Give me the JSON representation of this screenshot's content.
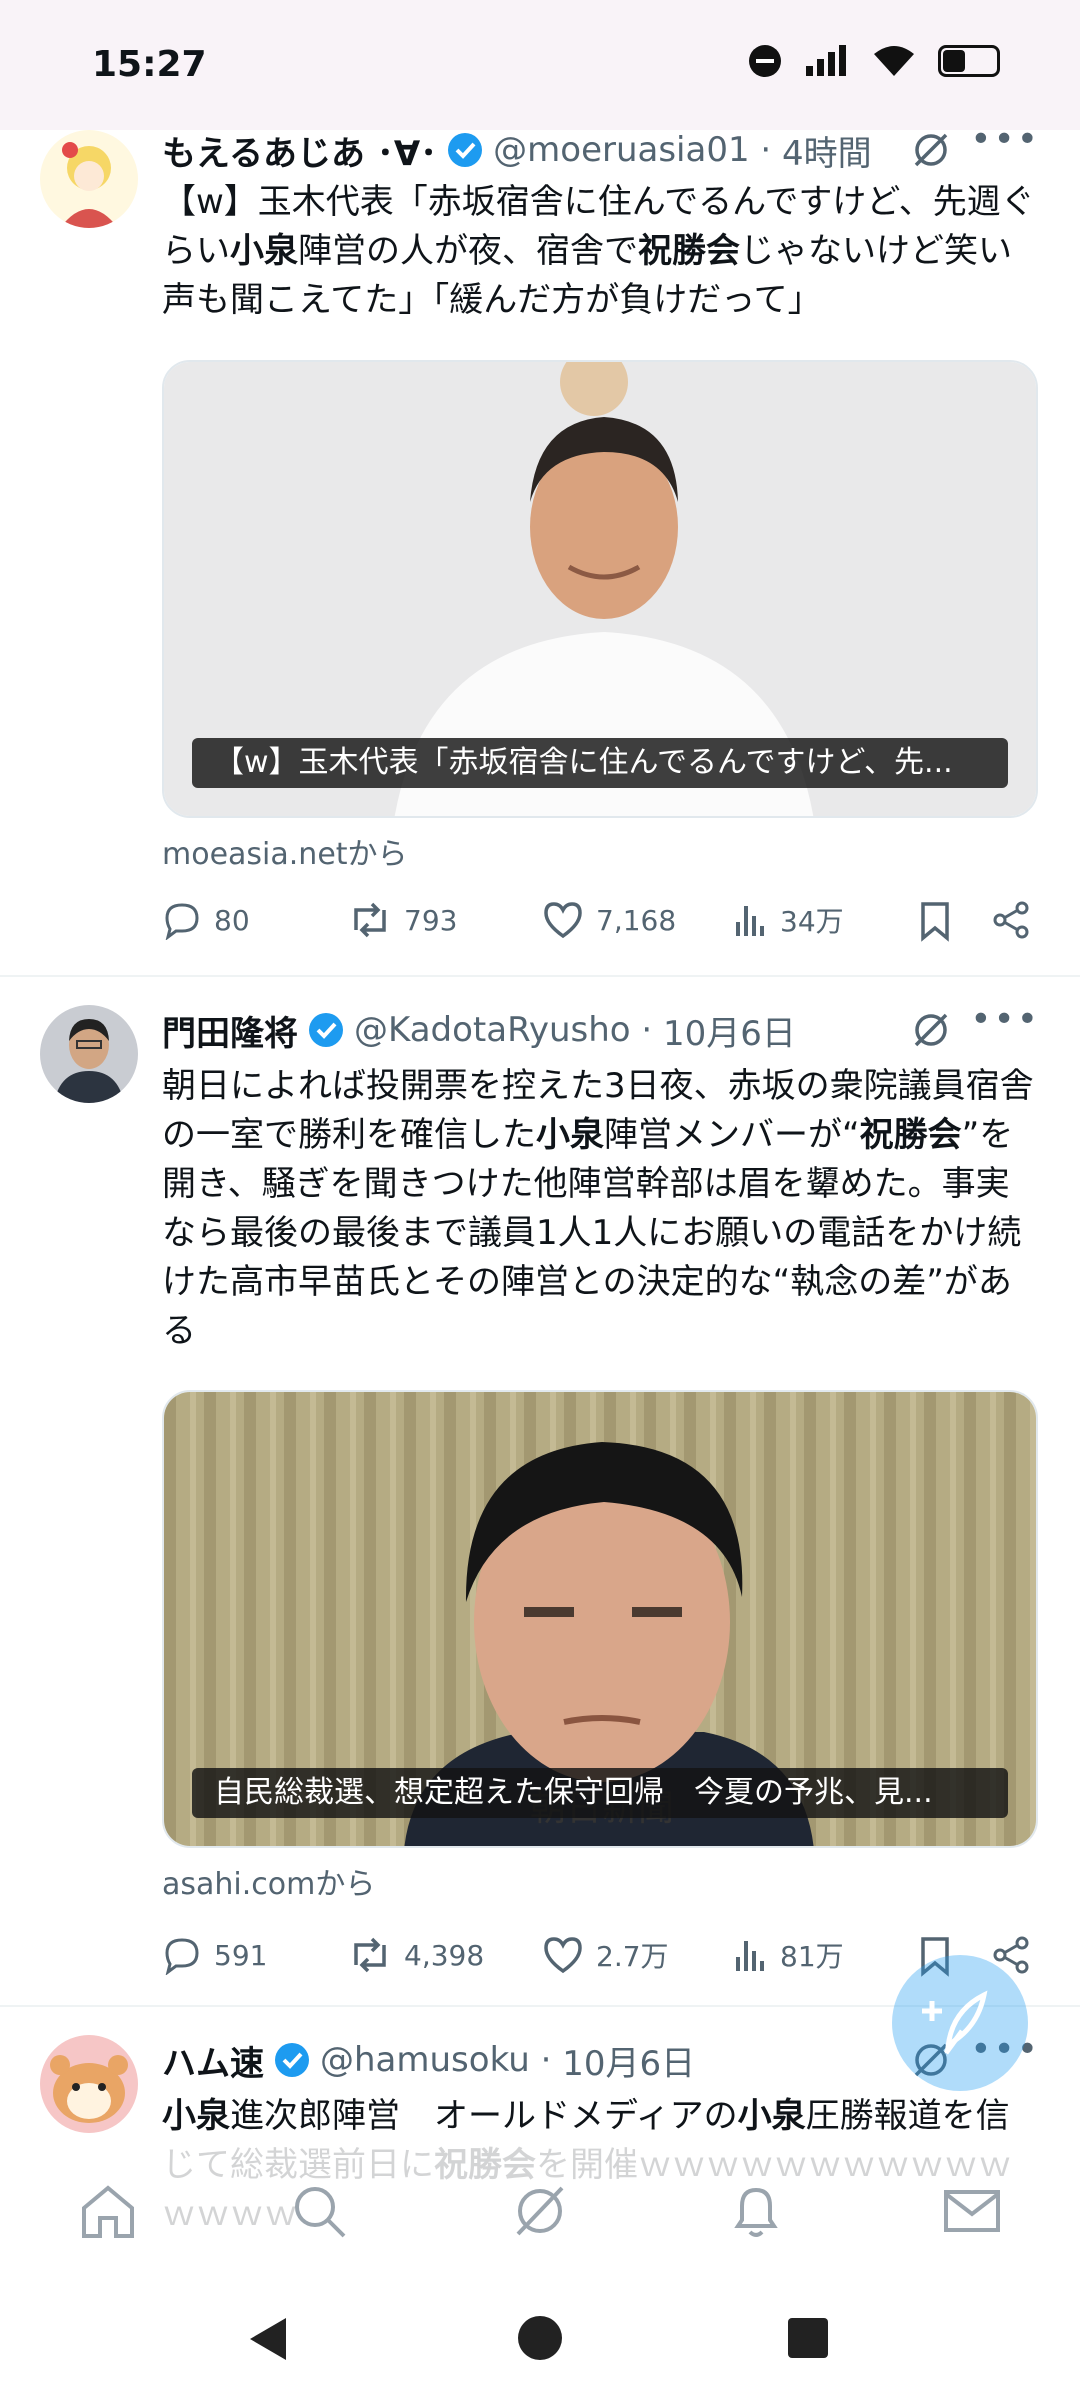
{
  "status_bar": {
    "time": "15:27"
  },
  "tweets": [
    {
      "name": "もえるあじあ ･∀･",
      "handle": "@moeruasia01",
      "time": "4時間",
      "segments": [
        {
          "t": "【w】玉木代表「赤坂宿舎に住んでるんですけど、先週ぐらい",
          "b": false
        },
        {
          "t": "小泉",
          "b": true
        },
        {
          "t": "陣営の人が夜、宿舎で",
          "b": false
        },
        {
          "t": "祝勝会",
          "b": true
        },
        {
          "t": "じゃないけど笑い声も聞こえてた」「緩んだ方が負けだって」",
          "b": false
        }
      ],
      "caption": "【w】玉木代表「赤坂宿舎に住んでるんですけど、先...",
      "source": "moeasia.netから",
      "replies": "80",
      "retweets": "793",
      "likes": "7,168",
      "views": "34万"
    },
    {
      "name": "門田隆将",
      "handle": "@KadotaRyusho",
      "time": "10月6日",
      "segments": [
        {
          "t": "朝日によれば投開票を控えた3日夜、赤坂の衆院議員宿舎の一室で勝利を確信した",
          "b": false
        },
        {
          "t": "小泉",
          "b": true
        },
        {
          "t": "陣営メンバーが“",
          "b": false
        },
        {
          "t": "祝勝会",
          "b": true
        },
        {
          "t": "”を開き、騒ぎを聞きつけた他陣営幹部は眉を顰めた。事実なら最後の最後まで議員1人1人にお願いの電話をかけ続けた高市早苗氏とその陣営との決定的な“執念の差”がある",
          "b": false
        }
      ],
      "caption": "自民総裁選、想定超えた保守回帰　今夏の予兆、見...",
      "watermark": "朝日新聞",
      "source": "asahi.comから",
      "replies": "591",
      "retweets": "4,398",
      "likes": "2.7万",
      "views": "81万"
    },
    {
      "name": "ハム速",
      "handle": "@hamusoku",
      "time": "10月6日",
      "segments": [
        {
          "t": "小泉",
          "b": true
        },
        {
          "t": "進次郎陣営　オールドメディアの",
          "b": false
        },
        {
          "t": "小泉",
          "b": true
        },
        {
          "t": "圧勝報道を信じて総裁選前日に",
          "b": false
        },
        {
          "t": "祝勝会",
          "b": true
        },
        {
          "t": "を開催ｗｗｗｗｗｗｗｗｗｗｗｗｗｗｗ",
          "b": false
        }
      ]
    }
  ],
  "icons": {
    "reply": "reply-icon",
    "retweet": "retweet-icon",
    "like": "heart-icon",
    "views": "views-icon",
    "bookmark": "bookmark-icon",
    "share": "share-icon",
    "grok": "grok-icon",
    "more": "more-icon",
    "verified": "verified-badge-icon",
    "compose": "compose-icon"
  },
  "colors": {
    "verified": "#1d9bf0",
    "meta": "#536471",
    "divider": "#eff3f4",
    "fab": "#1d9bf0"
  }
}
